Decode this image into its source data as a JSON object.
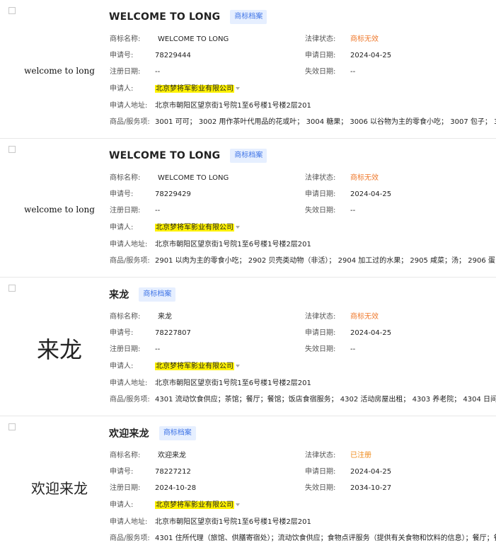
{
  "labels": {
    "name": "商标名称:",
    "app_no": "申请号:",
    "reg_date": "注册日期:",
    "applicant": "申请人:",
    "address": "申请人地址:",
    "goods": "商品/服务项:",
    "legal_status": "法律状态:",
    "app_date": "申请日期:",
    "expire_date": "失效日期:"
  },
  "tag_label": "商标档案",
  "items": [
    {
      "title": "WELCOME TO LONG",
      "thumb_text": "welcome to long",
      "name": "WELCOME TO LONG",
      "app_no": "78229444",
      "reg_date": "--",
      "applicant": "北京梦将军影业有限公司",
      "address": "北京市朝阳区望京街1号院1至6号楼1号楼2层201",
      "goods": "3001 可可； 3002 用作茶叶代用品的花或叶； 3004 糖果； 3006 以谷物为主的零食小吃； 3007 包子； 300",
      "legal_status": "商标无效",
      "app_date": "2024-04-25",
      "expire_date": "--"
    },
    {
      "title": "WELCOME TO LONG",
      "thumb_text": "welcome to long",
      "name": "WELCOME TO LONG",
      "app_no": "78229429",
      "reg_date": "--",
      "applicant": "北京梦将军影业有限公司",
      "address": "北京市朝阳区望京街1号院1至6号楼1号楼2层201",
      "goods": "2901 以肉为主的零食小吃； 2902 贝壳类动物（非活）； 2904 加工过的水果； 2905 咸菜；汤； 2906 蛋；",
      "legal_status": "商标无效",
      "app_date": "2024-04-25",
      "expire_date": "--"
    },
    {
      "title": "来龙",
      "thumb_text": "来龙",
      "name": "来龙",
      "app_no": "78227807",
      "reg_date": "--",
      "applicant": "北京梦将军影业有限公司",
      "address": "北京市朝阳区望京街1号院1至6号楼1号楼2层201",
      "goods": "4301 流动饮食供应；茶馆；餐厅；餐馆；饭店食宿服务； 4302 活动房屋出租； 4303 养老院； 4304 日间托",
      "legal_status": "商标无效",
      "app_date": "2024-04-25",
      "expire_date": "--"
    },
    {
      "title": "欢迎来龙",
      "thumb_text": "欢迎来龙",
      "name": "欢迎来龙",
      "app_no": "78227212",
      "reg_date": "2024-10-28",
      "applicant": "北京梦将军影业有限公司",
      "address": "北京市朝阳区望京街1号院1至6号楼1号楼2层201",
      "goods": "4301 住所代理（旅馆、供膳寄宿处）；流动饮食供应；食物点评服务（提供有关食物和饮料的信息）；餐厅；餐",
      "legal_status": "已注册",
      "app_date": "2024-04-25",
      "expire_date": "2034-10-27"
    }
  ],
  "colors": {
    "tag_bg": "#e6efff",
    "tag_text": "#3f74e6",
    "status_invalid": "#ef7a2e",
    "status_registered": "#ef8a1a",
    "applicant_highlight": "#fff200"
  }
}
